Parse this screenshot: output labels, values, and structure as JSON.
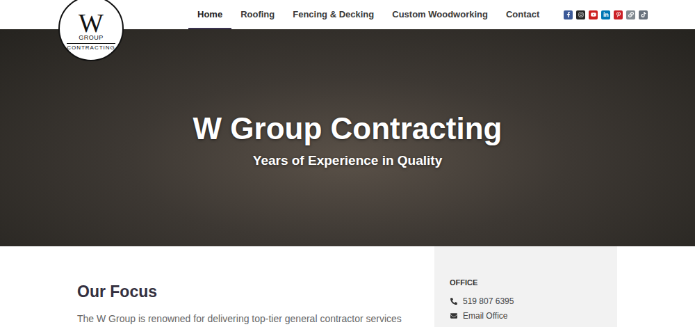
{
  "header": {
    "logo": {
      "letter": "W",
      "line1": "GROUP",
      "line2": "CONTRACTING"
    },
    "nav": [
      {
        "label": "Home",
        "selected": true
      },
      {
        "label": "Roofing",
        "selected": false
      },
      {
        "label": "Fencing & Decking",
        "selected": false
      },
      {
        "label": "Custom Woodworking",
        "selected": false
      },
      {
        "label": "Contact",
        "selected": false
      }
    ],
    "social": [
      {
        "kind": "facebook",
        "color": "#3b5998"
      },
      {
        "kind": "instagram",
        "color": "#262626"
      },
      {
        "kind": "youtube",
        "color": "#cd201f"
      },
      {
        "kind": "linkedin",
        "color": "#0077b5"
      },
      {
        "kind": "pinterest",
        "color": "#cb2027"
      },
      {
        "kind": "link",
        "color": "#818a91"
      },
      {
        "kind": "tiktok",
        "color": "#69727d"
      }
    ]
  },
  "hero": {
    "title": "W Group Contracting",
    "subtitle": "Years of Experience in Quality"
  },
  "focus": {
    "heading": "Our Focus",
    "text": "The W Group is renowned for delivering top-tier general contractor services"
  },
  "office": {
    "heading": "OFFICE",
    "items": [
      {
        "kind": "phone",
        "text": "519 807 6395"
      },
      {
        "kind": "email",
        "text": "Email Office"
      }
    ]
  }
}
